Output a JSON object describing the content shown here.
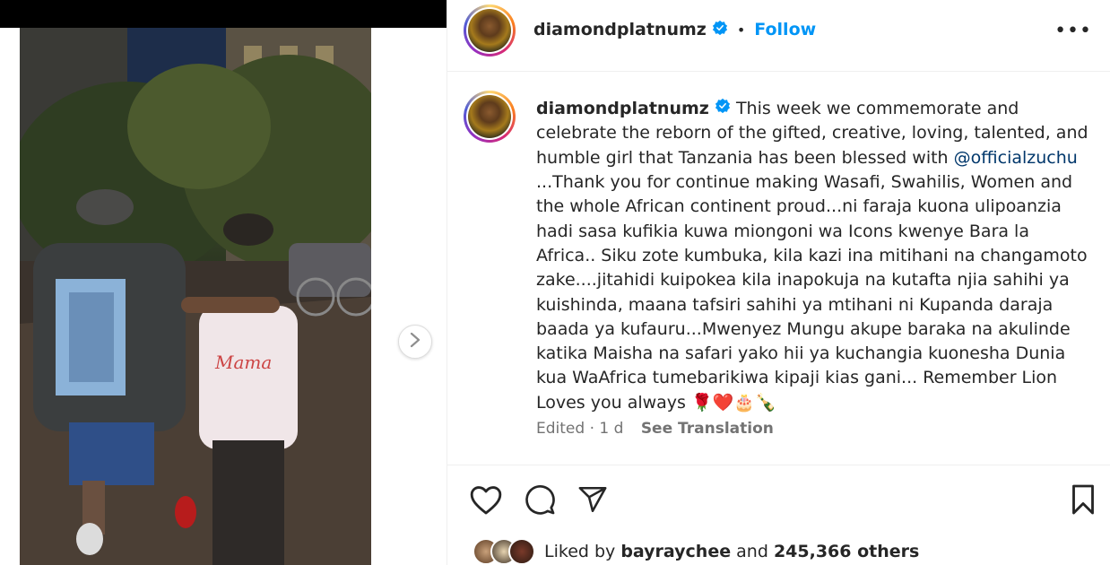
{
  "post": {
    "username": "diamondplatnumz",
    "follow_label": "Follow",
    "separator": "•",
    "more_label": "•••",
    "caption_parts": {
      "p1": "This week we commemorate and celebrate the reborn of the gifted, creative, loving, talented, and humble girl that Tanzania has been blessed with ",
      "mention": "@officialzuchu",
      "p2": " ...Thank you for continue making Wasafi, Swahilis, Women and the whole African continent proud...ni faraja kuona ulipoanzia hadi sasa kufikia kuwa miongoni wa Icons kwenye Bara la Africa.. Siku zote kumbuka, kila kazi ina mitihani na changamoto zake....jitahidi kuipokea kila inapokuja na kutafta njia sahihi ya kuishinda, maana tafsiri sahihi ya mtihani ni Kupanda daraja baada ya kufauru...Mwenyez Mungu akupe baraka na akulinde katika Maisha na safari yako hii ya kuchangia kuonesha Dunia kua WaAfrica tumebarikiwa kipaji kias gani... Remember Lion Loves you always ",
      "emojis": "🌹❤️🎂🍾"
    },
    "edited_label": "Edited · 1 d",
    "see_translation": "See Translation",
    "liked_by_prefix": "Liked by ",
    "liked_by_user": "bayraychee",
    "liked_by_and": " and ",
    "likes_count": "245,366 others"
  },
  "icons": {
    "like": "heart-icon",
    "comment": "comment-icon",
    "share": "share-icon",
    "save": "bookmark-icon",
    "next": "chevron-right-icon",
    "verified": "verified-badge-icon"
  },
  "colors": {
    "accent": "#0095f6",
    "verified": "#0095f6",
    "mention": "#00376b",
    "muted": "#737373",
    "text": "#262626"
  }
}
